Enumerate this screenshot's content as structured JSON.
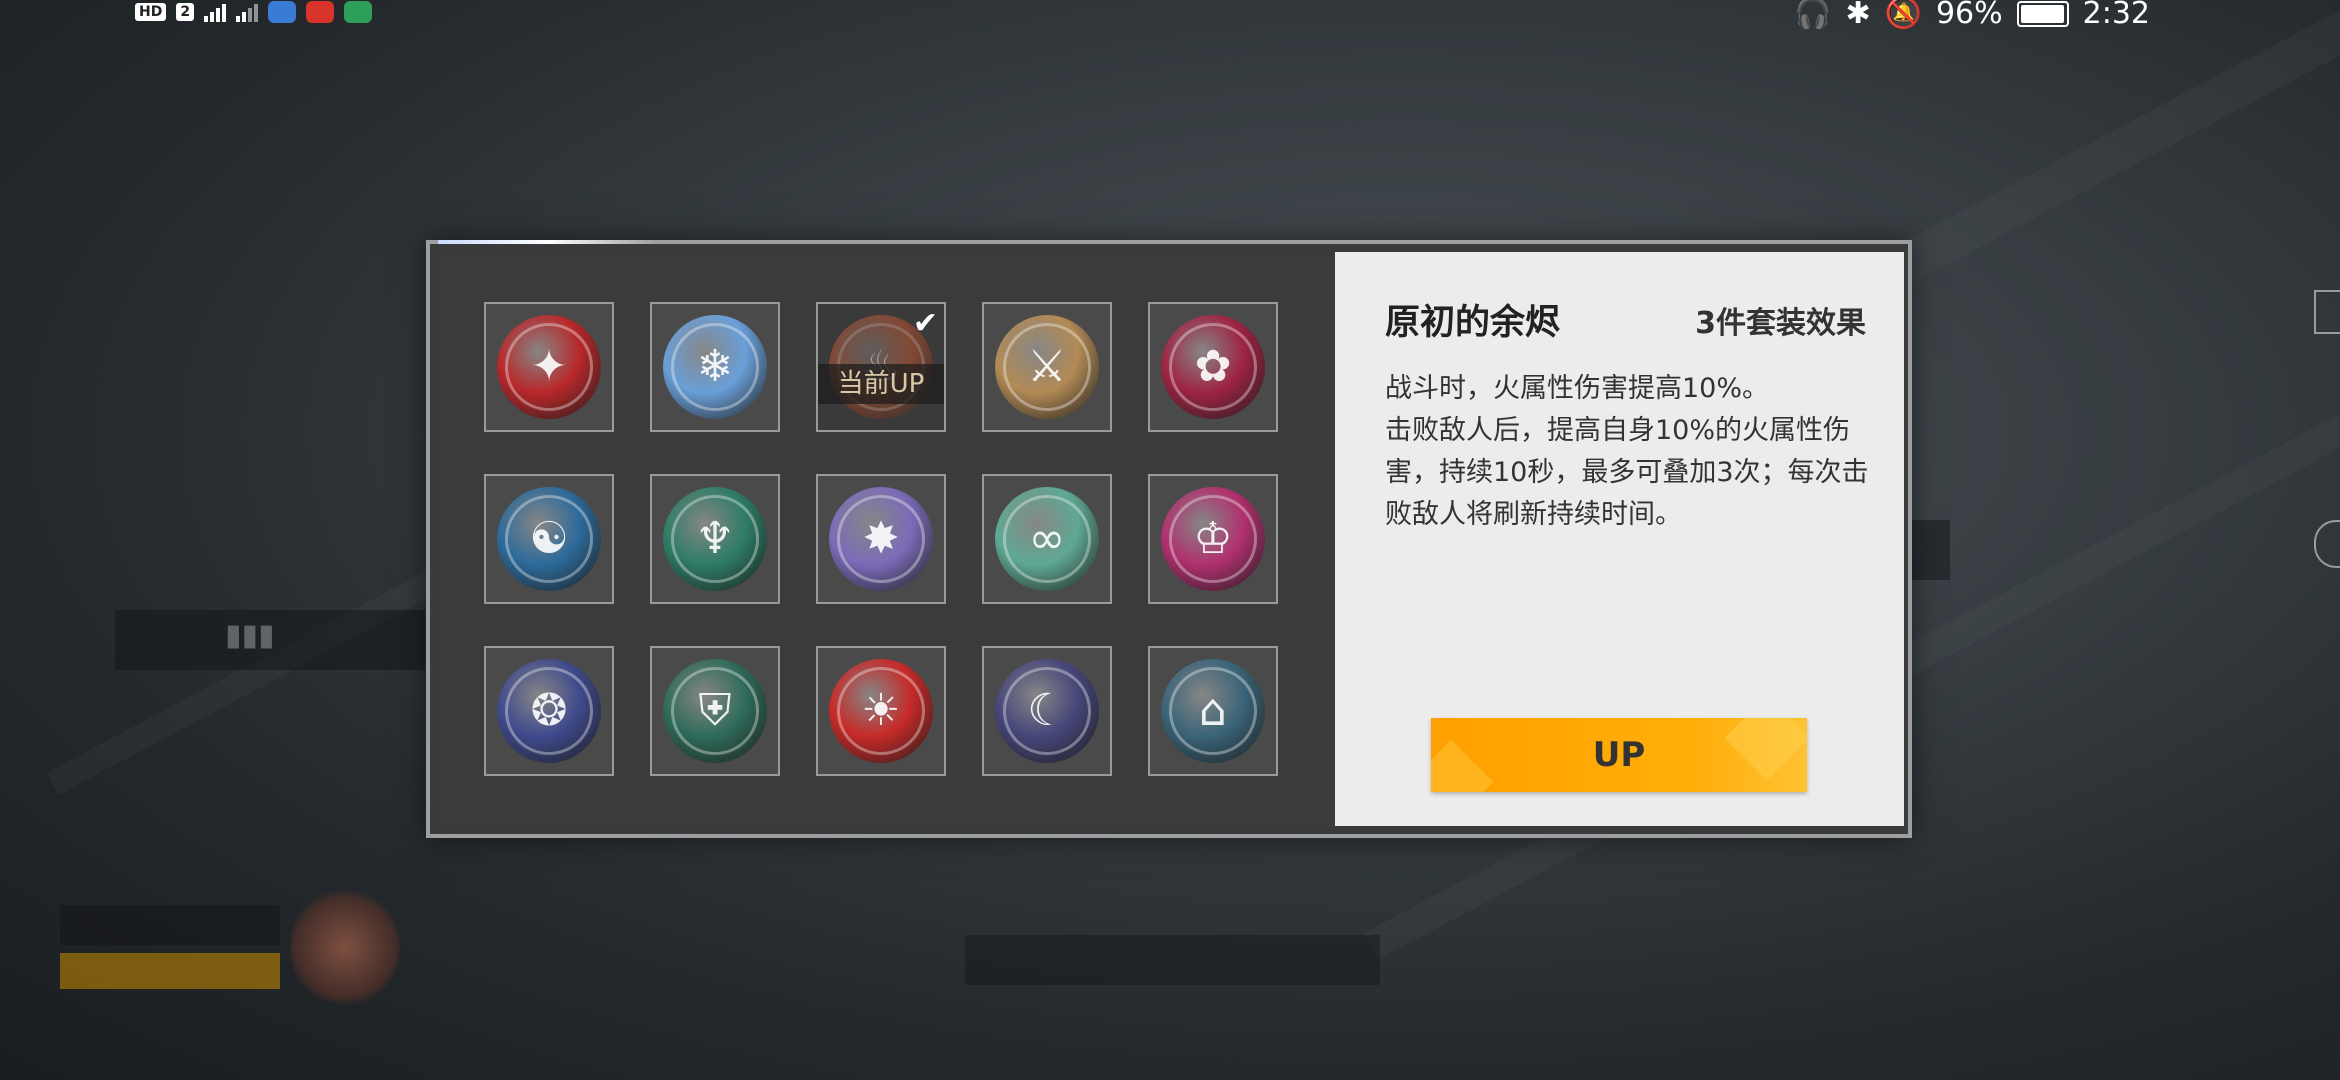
{
  "status_bar": {
    "left_badges": [
      "HD",
      "2"
    ],
    "battery_percent": "96%",
    "time": "2:32"
  },
  "set_panel": {
    "current_up_label": "当前UP",
    "selected_index": 2,
    "emblems": [
      {
        "icon": "crimson-crest-emblem-icon",
        "color": "#b8282a"
      },
      {
        "icon": "azure-antler-emblem-icon",
        "color": "#6a9fd8"
      },
      {
        "icon": "flame-emblem-icon",
        "color": "#c0552f"
      },
      {
        "icon": "winged-sword-emblem-icon",
        "color": "#b28a55"
      },
      {
        "icon": "fox-mask-emblem-icon",
        "color": "#9e2443"
      },
      {
        "icon": "blue-dragon-emblem-icon",
        "color": "#2d6a9a"
      },
      {
        "icon": "green-serpent-emblem-icon",
        "color": "#2e7c66"
      },
      {
        "icon": "violet-beast-emblem-icon",
        "color": "#7b6bb8"
      },
      {
        "icon": "infinity-knot-emblem-icon",
        "color": "#5fa893"
      },
      {
        "icon": "chalice-emblem-icon",
        "color": "#b0306e"
      },
      {
        "icon": "winged-shell-emblem-icon",
        "color": "#3f4a8c"
      },
      {
        "icon": "spartan-helmet-emblem-icon",
        "color": "#2f6b5a"
      },
      {
        "icon": "sun-banner-emblem-icon",
        "color": "#c62a28"
      },
      {
        "icon": "crescent-arrow-emblem-icon",
        "color": "#46467a"
      },
      {
        "icon": "temple-emblem-icon",
        "color": "#3a6478"
      }
    ]
  },
  "detail_panel": {
    "set_name": "原初的余烬",
    "set_effect": "3件套装效果",
    "description": [
      "战斗时，火属性伤害提高10%。",
      "击败敌人后，提高自身10%的火属性伤害，持续10秒，最多可叠加3次；每次击败敌人将刷新持续时间。"
    ],
    "up_button": "UP"
  }
}
